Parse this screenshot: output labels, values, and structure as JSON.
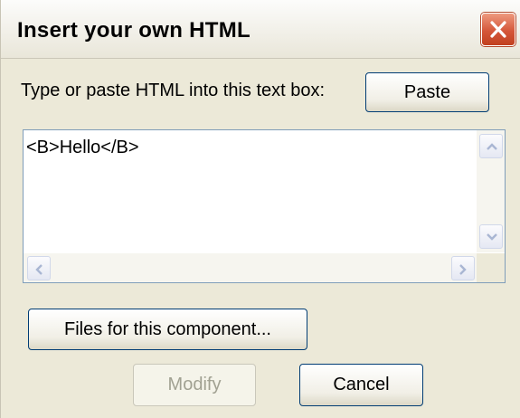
{
  "dialog": {
    "title": "Insert your own HTML",
    "close_icon": "close-x-icon",
    "accent_color": "#d5573a"
  },
  "prompt": {
    "label": "Type or paste HTML into this text box:",
    "paste_label": "Paste"
  },
  "editor": {
    "value": "<B>Hello</B>",
    "scroll_icons": [
      "scroll-up-icon",
      "scroll-down-icon",
      "scroll-left-icon",
      "scroll-right-icon"
    ]
  },
  "buttons": {
    "files_label": "Files for this component...",
    "modify_label": "Modify",
    "cancel_label": "Cancel"
  }
}
